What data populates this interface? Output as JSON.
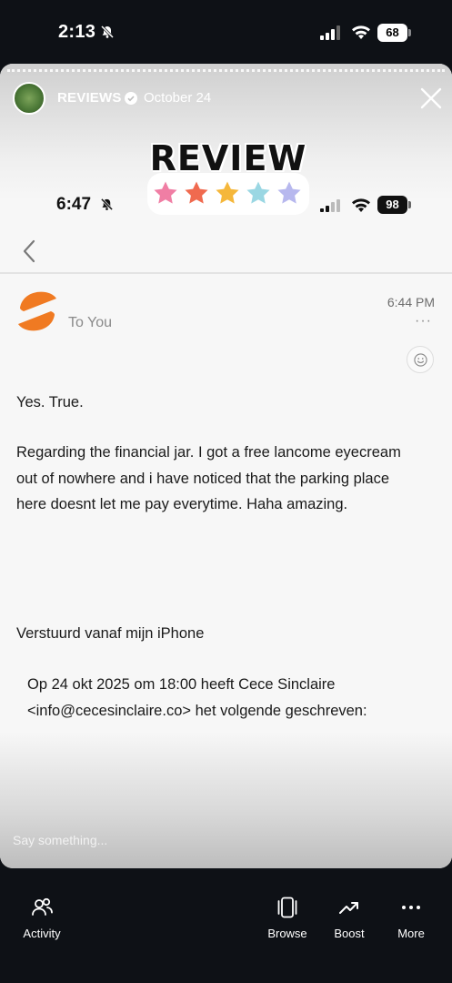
{
  "os_status": {
    "time": "2:13",
    "battery": "68"
  },
  "story": {
    "account": "REVIEWS",
    "date": "October 24",
    "sticker_text": "REVIEW",
    "star_colors": [
      "#f07ea4",
      "#f06a4f",
      "#f5b73b",
      "#9ad7e3",
      "#b7b8ee"
    ],
    "reply_placeholder": "Say something..."
  },
  "inner_status": {
    "time": "6:47",
    "battery": "98"
  },
  "email": {
    "recipient": "To You",
    "time": "6:44 PM",
    "more": "···",
    "line1": "Yes. True.",
    "paragraph": "Regarding the financial jar. I got a free lancome eyecream out of nowhere and i have noticed that the parking place here doesnt let me pay everytime. Haha amazing.",
    "signature": "Verstuurd vanaf mijn iPhone",
    "quote": "Op 24 okt 2025 om 18:00 heeft Cece Sinclaire <info@cecesinclaire.co> het volgende geschreven:"
  },
  "bottom_nav": {
    "activity": "Activity",
    "browse": "Browse",
    "boost": "Boost",
    "more": "More"
  }
}
